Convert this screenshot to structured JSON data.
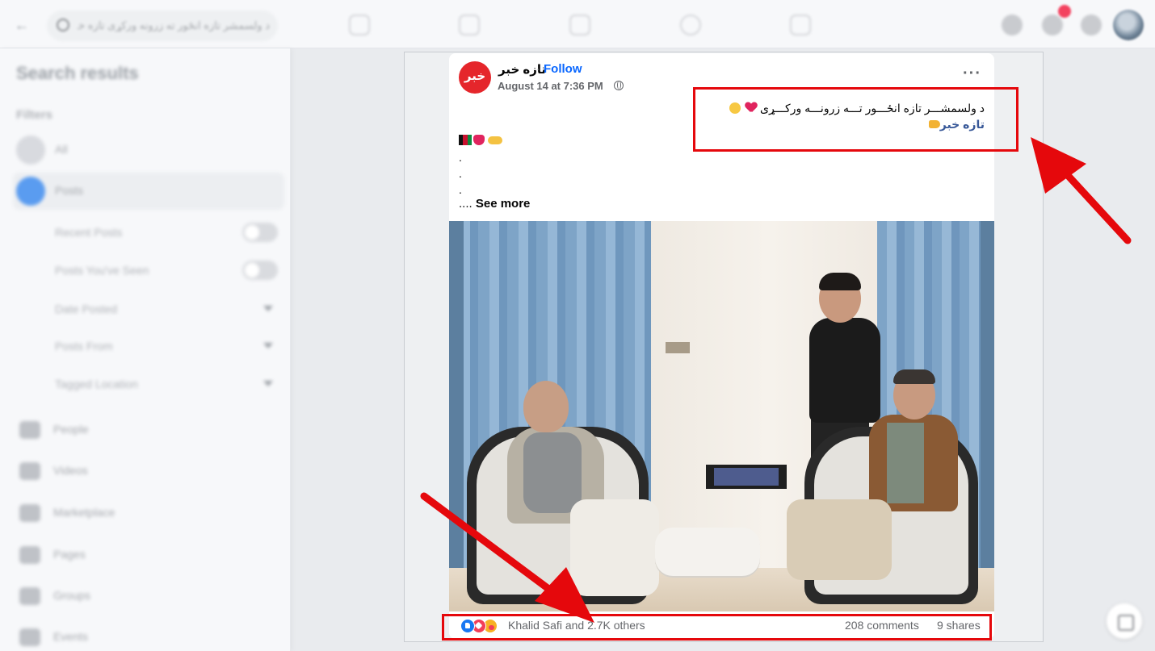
{
  "topbar": {
    "search_text": "د ولسمشر تازه انځور ته زرونه ورکړی تازه خبر"
  },
  "sidebar": {
    "title": "Search results",
    "filters_label": "Filters",
    "items": [
      {
        "label": "All",
        "icon": "all-icon"
      },
      {
        "label": "Posts",
        "icon": "posts-icon",
        "active": true
      }
    ],
    "sub_filters": [
      {
        "label": "Recent Posts",
        "control": "toggle"
      },
      {
        "label": "Posts You've Seen",
        "control": "toggle"
      },
      {
        "label": "Date Posted",
        "control": "dropdown"
      },
      {
        "label": "Posts From",
        "control": "dropdown"
      },
      {
        "label": "Tagged Location",
        "control": "dropdown"
      }
    ],
    "categories": [
      {
        "label": "People",
        "icon": "people-icon"
      },
      {
        "label": "Videos",
        "icon": "videos-icon"
      },
      {
        "label": "Marketplace",
        "icon": "marketplace-icon"
      },
      {
        "label": "Pages",
        "icon": "pages-icon"
      },
      {
        "label": "Groups",
        "icon": "groups-icon"
      },
      {
        "label": "Events",
        "icon": "events-icon"
      }
    ]
  },
  "post": {
    "avatar_text": "خبر",
    "page_name": "تازه خبر",
    "separator": "·",
    "follow_label": "Follow",
    "timestamp": "August 14 at 7:36 PM",
    "text_line1": "د ولسمشـــر تازه انځـــور تـــه زرونـــه ورکـــړی",
    "hashtag": "تازه خبر",
    "dots": [
      ".",
      ".",
      "."
    ],
    "see_more_prefix": "....",
    "see_more_label": "See more",
    "reactions_text": "Khalid Safi and 2.7K others",
    "comments_text": "208 comments",
    "shares_text": "9 shares"
  },
  "colors": {
    "annotation_red": "#e5080c",
    "link_blue": "#0866ff",
    "hashtag_blue": "#385898",
    "like_blue": "#1877f2",
    "love_red": "#f33e58"
  }
}
